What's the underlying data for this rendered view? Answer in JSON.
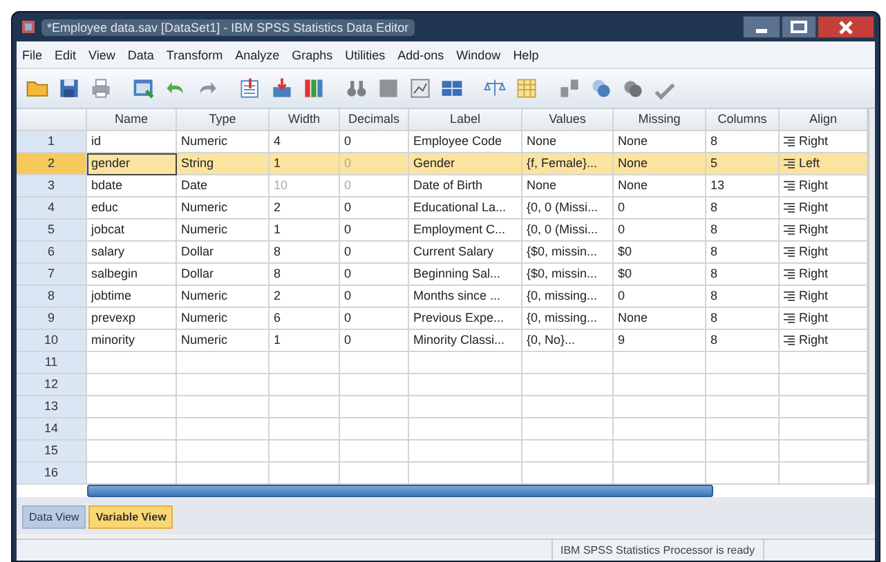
{
  "window": {
    "title": "*Employee data.sav [DataSet1] - IBM SPSS Statistics Data Editor"
  },
  "menu": [
    "File",
    "Edit",
    "View",
    "Data",
    "Transform",
    "Analyze",
    "Graphs",
    "Utilities",
    "Add-ons",
    "Window",
    "Help"
  ],
  "table": {
    "columns": [
      "Name",
      "Type",
      "Width",
      "Decimals",
      "Label",
      "Values",
      "Missing",
      "Columns",
      "Align"
    ],
    "rows": [
      {
        "number": "1",
        "selected": false,
        "cells": [
          "id",
          "Numeric",
          "4",
          "0",
          "Employee Code",
          "None",
          "None",
          "8",
          "Right"
        ],
        "disabled": [
          false,
          false,
          false,
          false,
          false,
          false,
          false,
          false,
          false
        ]
      },
      {
        "number": "2",
        "selected": true,
        "cells": [
          "gender",
          "String",
          "1",
          "0",
          "Gender",
          "{f, Female}...",
          "None",
          "5",
          "Left"
        ],
        "disabled": [
          false,
          false,
          false,
          true,
          false,
          false,
          false,
          false,
          false
        ]
      },
      {
        "number": "3",
        "selected": false,
        "cells": [
          "bdate",
          "Date",
          "10",
          "0",
          "Date of Birth",
          "None",
          "None",
          "13",
          "Right"
        ],
        "disabled": [
          false,
          false,
          true,
          true,
          false,
          false,
          false,
          false,
          false
        ]
      },
      {
        "number": "4",
        "selected": false,
        "cells": [
          "educ",
          "Numeric",
          "2",
          "0",
          "Educational La...",
          "{0, 0 (Missi...",
          "0",
          "8",
          "Right"
        ],
        "disabled": [
          false,
          false,
          false,
          false,
          false,
          false,
          false,
          false,
          false
        ]
      },
      {
        "number": "5",
        "selected": false,
        "cells": [
          "jobcat",
          "Numeric",
          "1",
          "0",
          "Employment C...",
          "{0, 0 (Missi...",
          "0",
          "8",
          "Right"
        ],
        "disabled": [
          false,
          false,
          false,
          false,
          false,
          false,
          false,
          false,
          false
        ]
      },
      {
        "number": "6",
        "selected": false,
        "cells": [
          "salary",
          "Dollar",
          "8",
          "0",
          "Current Salary",
          "{$0, missin...",
          "$0",
          "8",
          "Right"
        ],
        "disabled": [
          false,
          false,
          false,
          false,
          false,
          false,
          false,
          false,
          false
        ]
      },
      {
        "number": "7",
        "selected": false,
        "cells": [
          "salbegin",
          "Dollar",
          "8",
          "0",
          "Beginning Sal...",
          "{$0, missin...",
          "$0",
          "8",
          "Right"
        ],
        "disabled": [
          false,
          false,
          false,
          false,
          false,
          false,
          false,
          false,
          false
        ]
      },
      {
        "number": "8",
        "selected": false,
        "cells": [
          "jobtime",
          "Numeric",
          "2",
          "0",
          "Months since ...",
          "{0, missing...",
          "0",
          "8",
          "Right"
        ],
        "disabled": [
          false,
          false,
          false,
          false,
          false,
          false,
          false,
          false,
          false
        ]
      },
      {
        "number": "9",
        "selected": false,
        "cells": [
          "prevexp",
          "Numeric",
          "6",
          "0",
          "Previous Expe...",
          "{0, missing...",
          "None",
          "8",
          "Right"
        ],
        "disabled": [
          false,
          false,
          false,
          false,
          false,
          false,
          false,
          false,
          false
        ]
      },
      {
        "number": "10",
        "selected": false,
        "cells": [
          "minority",
          "Numeric",
          "1",
          "0",
          "Minority Classi...",
          "{0, No}...",
          "9",
          "8",
          "Right"
        ],
        "disabled": [
          false,
          false,
          false,
          false,
          false,
          false,
          false,
          false,
          false
        ]
      },
      {
        "number": "11",
        "selected": false
      },
      {
        "number": "12",
        "selected": false
      },
      {
        "number": "13",
        "selected": false
      },
      {
        "number": "14",
        "selected": false
      },
      {
        "number": "15",
        "selected": false
      },
      {
        "number": "16",
        "selected": false
      }
    ]
  },
  "tabs": [
    {
      "label": "Data View",
      "selected": false
    },
    {
      "label": "Variable View",
      "selected": true
    }
  ],
  "status_bar": {
    "text": "IBM SPSS Statistics Processor is ready"
  }
}
